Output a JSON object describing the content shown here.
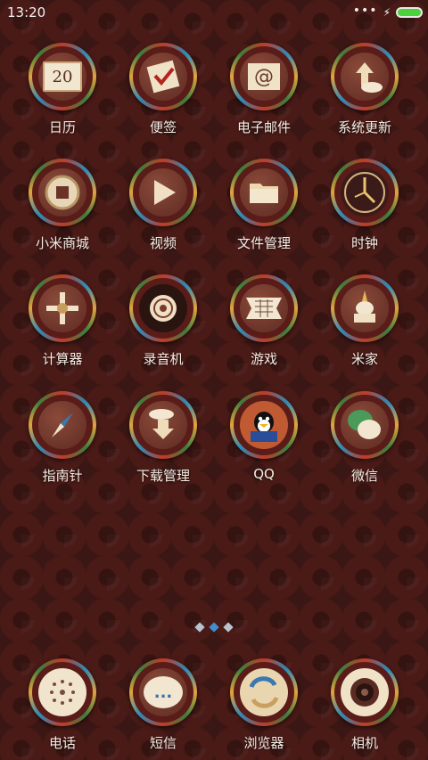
{
  "status_bar": {
    "time": "13:20",
    "more": "•••",
    "charging": "⚡"
  },
  "apps": [
    {
      "label": "日历",
      "icon": "calendar-icon",
      "text": "20"
    },
    {
      "label": "便签",
      "icon": "notes-icon"
    },
    {
      "label": "电子邮件",
      "icon": "email-icon",
      "text": "@"
    },
    {
      "label": "系统更新",
      "icon": "update-icon"
    },
    {
      "label": "小米商城",
      "icon": "mi-store-icon"
    },
    {
      "label": "视频",
      "icon": "video-icon"
    },
    {
      "label": "文件管理",
      "icon": "folder-icon"
    },
    {
      "label": "时钟",
      "icon": "clock-icon"
    },
    {
      "label": "计算器",
      "icon": "calculator-icon"
    },
    {
      "label": "录音机",
      "icon": "recorder-icon"
    },
    {
      "label": "游戏",
      "icon": "game-icon"
    },
    {
      "label": "米家",
      "icon": "stupa-icon"
    },
    {
      "label": "指南针",
      "icon": "compass-icon"
    },
    {
      "label": "下载管理",
      "icon": "download-icon"
    },
    {
      "label": "QQ",
      "icon": "qq-penguin-icon"
    },
    {
      "label": "微信",
      "icon": "wechat-icon"
    }
  ],
  "dock": [
    {
      "label": "电话",
      "icon": "phone-icon"
    },
    {
      "label": "短信",
      "icon": "message-icon",
      "text": "..."
    },
    {
      "label": "浏览器",
      "icon": "browser-icon"
    },
    {
      "label": "相机",
      "icon": "camera-icon"
    }
  ],
  "colors": {
    "background": "#3a1614",
    "accent": "#3f8fd0",
    "battery": "#4ad13c"
  }
}
